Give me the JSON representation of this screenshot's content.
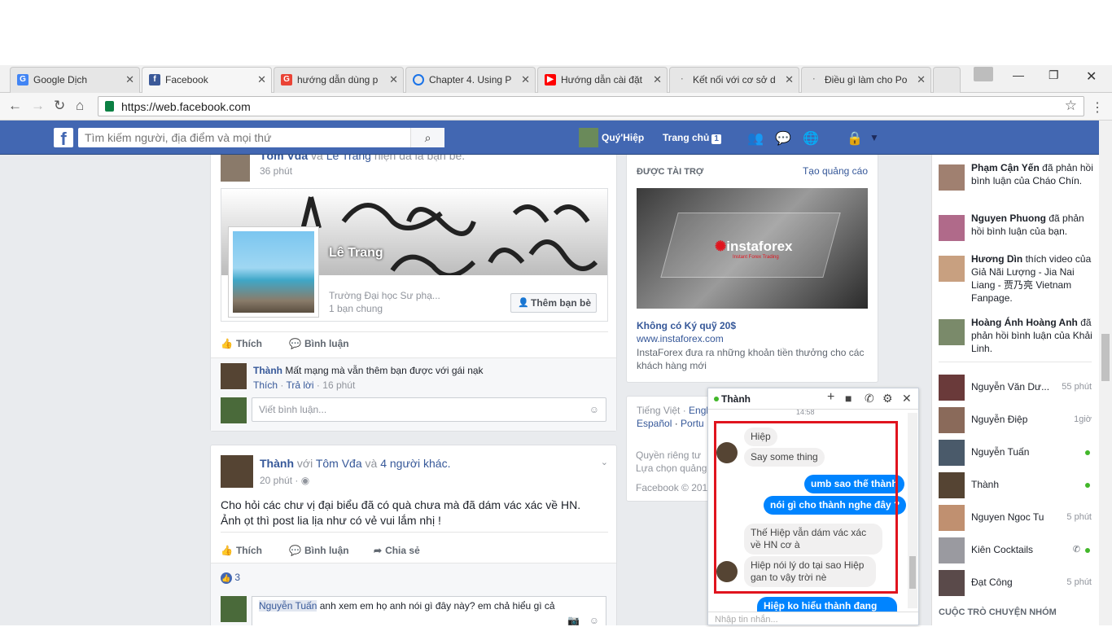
{
  "browser": {
    "tabs": [
      {
        "label": "Google Dịch",
        "icon": "google-translate-icon",
        "color": "#4285f4"
      },
      {
        "label": "Facebook",
        "icon": "facebook-icon",
        "color": "#3b5998"
      },
      {
        "label": "hướng dẫn dùng p",
        "icon": "google-icon",
        "color": "#ea4335"
      },
      {
        "label": "Chapter 4. Using P",
        "icon": "loading-icon",
        "color": "#1a73e8"
      },
      {
        "label": "Hướng dẫn cài đặt",
        "icon": "youtube-icon",
        "color": "#ff0000"
      },
      {
        "label": "Kết nối với cơ sở d",
        "icon": "page-icon",
        "color": "#888888"
      },
      {
        "label": "Điều gì làm cho Po",
        "icon": "page-icon",
        "color": "#888888"
      }
    ],
    "url": "https://web.facebook.com"
  },
  "fb": {
    "search_placeholder": "Tìm kiếm người, địa điểm và mọi thứ",
    "user": "Quý'Hiệp",
    "home": "Trang chủ",
    "home_count": "1"
  },
  "post1": {
    "name1": "Tôm Vđa",
    "and": "và",
    "name2": "Lê Trang",
    "rest": "hiện đã là bạn bè.",
    "time": "36 phút",
    "cover_name": "Lê Trang",
    "school": "Trường Đại học Sư phạ...",
    "mutual": "1 bạn chung",
    "add_friend": "Thêm bạn bè",
    "like": "Thích",
    "comment": "Bình luận",
    "c_name": "Thành",
    "c_text": "Mất mạng mà vẫn thêm bạn được với gái nạk",
    "c_like": "Thích",
    "c_reply": "Trả lời",
    "c_time": "16 phút",
    "write_comment": "Viết bình luận..."
  },
  "post2": {
    "name": "Thành",
    "with": "với",
    "tag1": "Tôm Vđa",
    "and": "và",
    "others": "4 người khác.",
    "time": "20 phút ·",
    "line1": "Cho hỏi các chư vị đại biểu đã có quà chưa mà đã dám vác xác về HN.",
    "line2": "Ảnh ọt thì post lia lịa như có vẻ vui lắm nhị !",
    "like": "Thích",
    "comment": "Bình luận",
    "share": "Chia sẻ",
    "likes": "3",
    "c_name": "Nguyễn Tuấn",
    "c_text": "anh xem em họ anh nói gì đây này? em chả hiểu gì cả"
  },
  "ad": {
    "sponsored": "ĐƯỢC TÀI TRỢ",
    "create_ad": "Tạo quảng cáo",
    "brand": "instaforex",
    "brand_sub": "Instant Forex Trading",
    "title": "Không có Ký quỹ 20$",
    "site": "www.instaforex.com",
    "desc": "InstaForex đưa ra những khoản tiền thưởng cho các khách hàng mới"
  },
  "footer": {
    "l1a": "Tiếng Việt",
    "l1b": "Engl",
    "l2a": "Español",
    "l2b": "Portu",
    "l3": "Quyền riêng tư",
    "l4": "Lựa chọn quảng",
    "l5": "Facebook © 201"
  },
  "notifications": [
    {
      "name": "Phạm Cận Yến",
      "text": "đã phản hồi bình luận của Cháo Chín."
    },
    {
      "name": "Nguyen Phuong",
      "text": "đã phản hồi bình luận của bạn."
    },
    {
      "name": "Hương Dìn",
      "text": "thích video của Giả Nãi Lượng - Jia Nai Liang - 贾乃亮 Vietnam Fanpage."
    },
    {
      "name": "Hoàng Ánh Hoàng Anh",
      "text": "đã phản hồi bình luận của Khải Linh."
    }
  ],
  "contacts": [
    {
      "name": "Nguyễn Văn Dư...",
      "status": "55 phút"
    },
    {
      "name": "Nguyễn Điệp",
      "status": "1giờ"
    },
    {
      "name": "Nguyễn Tuấn",
      "status": ""
    },
    {
      "name": "Thành",
      "status": ""
    },
    {
      "name": "Nguyen Ngoc Tu",
      "status": "5 phút"
    },
    {
      "name": "Kiên Cocktails",
      "status": ""
    },
    {
      "name": "Đạt Công",
      "status": "5 phút"
    }
  ],
  "group_header": "CUỘC TRÒ CHUYỆN NHÓM",
  "chat": {
    "name": "Thành",
    "time": "14:58",
    "m1": "Hiệp",
    "m2": "Say some thing",
    "m3": "umb sao thế thành",
    "m4": "nói gì cho thành nghe đây ?",
    "m5": "Thế Hiệp vẫn dám vác xác về HN cơ à",
    "m6": "Hiệp nói lý do tại sao Hiệp gan to vậy trời nè",
    "m7": "Hiệp ko hiểu thành đang nói",
    "input": "Nhập tin nhắn..."
  }
}
